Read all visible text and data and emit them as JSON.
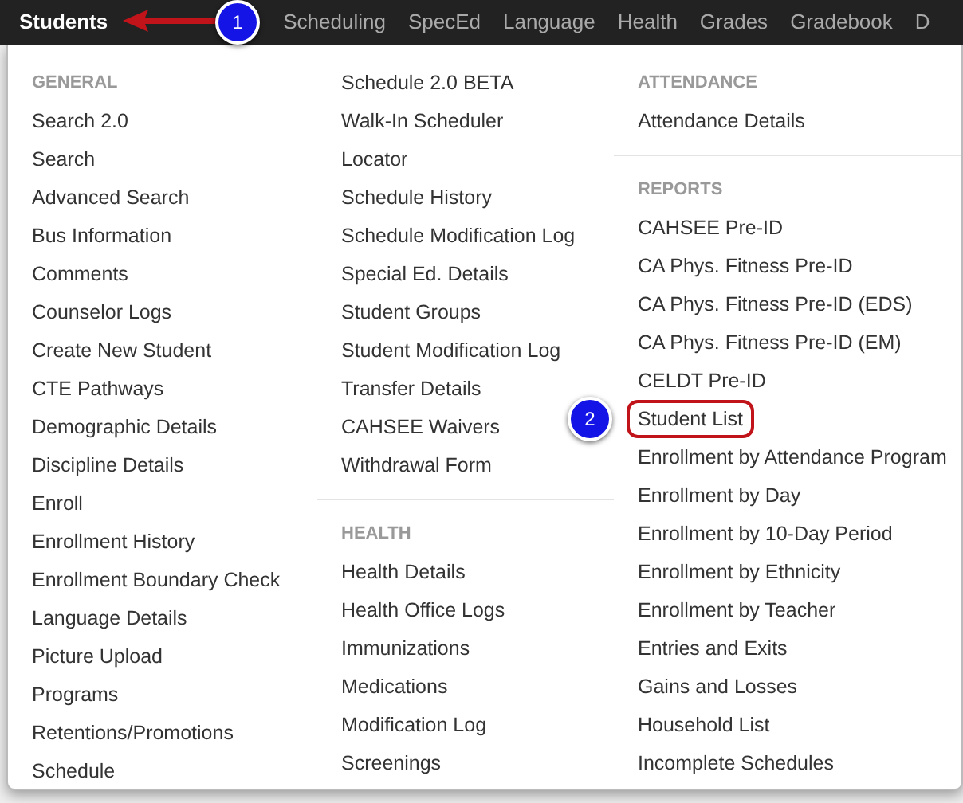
{
  "nav": [
    {
      "label": "Students",
      "selected": true
    },
    {
      "label": "Scheduling",
      "selected": false
    },
    {
      "label": "SpecEd",
      "selected": false
    },
    {
      "label": "Language",
      "selected": false
    },
    {
      "label": "Health",
      "selected": false
    },
    {
      "label": "Grades",
      "selected": false
    },
    {
      "label": "Gradebook",
      "selected": false
    },
    {
      "label": "D",
      "selected": false
    }
  ],
  "menu": {
    "columns": [
      {
        "sections": [
          {
            "header": "GENERAL",
            "items": [
              {
                "label": "Search 2.0",
                "highlighted": false
              },
              {
                "label": "Search",
                "highlighted": false
              },
              {
                "label": "Advanced Search",
                "highlighted": false
              },
              {
                "label": "Bus Information",
                "highlighted": false
              },
              {
                "label": "Comments",
                "highlighted": false
              },
              {
                "label": "Counselor Logs",
                "highlighted": false
              },
              {
                "label": "Create New Student",
                "highlighted": false
              },
              {
                "label": "CTE Pathways",
                "highlighted": false
              },
              {
                "label": "Demographic Details",
                "highlighted": false
              },
              {
                "label": "Discipline Details",
                "highlighted": false
              },
              {
                "label": "Enroll",
                "highlighted": false
              },
              {
                "label": "Enrollment History",
                "highlighted": false
              },
              {
                "label": "Enrollment Boundary Check",
                "highlighted": false
              },
              {
                "label": "Language Details",
                "highlighted": false
              },
              {
                "label": "Picture Upload",
                "highlighted": false
              },
              {
                "label": "Programs",
                "highlighted": false
              },
              {
                "label": "Retentions/Promotions",
                "highlighted": false
              },
              {
                "label": "Schedule",
                "highlighted": false
              }
            ]
          }
        ]
      },
      {
        "sections": [
          {
            "items": [
              {
                "label": "Schedule 2.0 BETA",
                "highlighted": false
              },
              {
                "label": "Walk-In Scheduler",
                "highlighted": false
              },
              {
                "label": "Locator",
                "highlighted": false
              },
              {
                "label": "Schedule History",
                "highlighted": false
              },
              {
                "label": "Schedule Modification Log",
                "highlighted": false
              },
              {
                "label": "Special Ed. Details",
                "highlighted": false
              },
              {
                "label": "Student Groups",
                "highlighted": false
              },
              {
                "label": "Student Modification Log",
                "highlighted": false
              },
              {
                "label": "Transfer Details",
                "highlighted": false
              },
              {
                "label": "CAHSEE Waivers",
                "highlighted": false
              },
              {
                "label": "Withdrawal Form",
                "highlighted": false
              }
            ]
          },
          {
            "header": "HEALTH",
            "items": [
              {
                "label": "Health Details",
                "highlighted": false
              },
              {
                "label": "Health Office Logs",
                "highlighted": false
              },
              {
                "label": "Immunizations",
                "highlighted": false
              },
              {
                "label": "Medications",
                "highlighted": false
              },
              {
                "label": "Modification Log",
                "highlighted": false
              },
              {
                "label": "Screenings",
                "highlighted": false
              }
            ]
          }
        ]
      },
      {
        "sections": [
          {
            "header": "ATTENDANCE",
            "items": [
              {
                "label": "Attendance Details",
                "highlighted": false
              }
            ]
          },
          {
            "header": "REPORTS",
            "items": [
              {
                "label": "CAHSEE Pre-ID",
                "highlighted": false
              },
              {
                "label": "CA Phys. Fitness Pre-ID",
                "highlighted": false
              },
              {
                "label": "CA Phys. Fitness Pre-ID (EDS)",
                "highlighted": false
              },
              {
                "label": "CA Phys. Fitness Pre-ID (EM)",
                "highlighted": false
              },
              {
                "label": "CELDT Pre-ID",
                "highlighted": false
              },
              {
                "label": "Student List",
                "highlighted": true
              },
              {
                "label": "Enrollment by Attendance Program",
                "highlighted": false
              },
              {
                "label": "Enrollment by Day",
                "highlighted": false
              },
              {
                "label": "Enrollment by 10-Day Period",
                "highlighted": false
              },
              {
                "label": "Enrollment by Ethnicity",
                "highlighted": false
              },
              {
                "label": "Enrollment by Teacher",
                "highlighted": false
              },
              {
                "label": "Entries and Exits",
                "highlighted": false
              },
              {
                "label": "Gains and Losses",
                "highlighted": false
              },
              {
                "label": "Household List",
                "highlighted": false
              },
              {
                "label": "Incomplete Schedules",
                "highlighted": false
              }
            ]
          }
        ]
      }
    ]
  },
  "annotations": [
    {
      "number": "1",
      "kind": "arrow"
    },
    {
      "number": "2",
      "kind": "outline"
    }
  ]
}
